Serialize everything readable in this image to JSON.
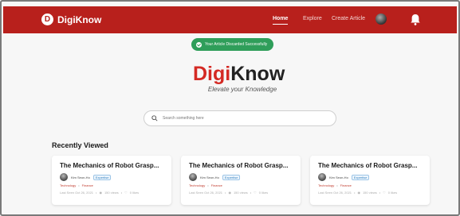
{
  "navbar": {
    "brand": "DigiKnow",
    "brand_logo": "D",
    "links": [
      "Home",
      "Explore",
      "Create Article"
    ],
    "active_link": "Home"
  },
  "toast": {
    "message": "Your Article Discarded Successfully",
    "color": "#2f9e5a"
  },
  "hero": {
    "logo_accent": "Digi",
    "logo_rest": "Know",
    "tagline": "Elevate your Knowledge"
  },
  "search": {
    "placeholder": "Search something here"
  },
  "recent": {
    "title": "Recently Viewed",
    "cards": [
      {
        "title": "The Mechanics of Robot Grasp...",
        "author": "Kim Seon-Ho",
        "badge": "Expertise",
        "tags": [
          "Technology",
          "Finance"
        ],
        "last_seen": "Last Seen Oct 26, 2021",
        "views": "150 views",
        "likes": "0 likes"
      },
      {
        "title": "The Mechanics of Robot Grasp...",
        "author": "Kim Seon-Ho",
        "badge": "Expertise",
        "tags": [
          "Technology",
          "Finance"
        ],
        "last_seen": "Last Seen Oct 26, 2021",
        "views": "150 views",
        "likes": "0 likes"
      },
      {
        "title": "The Mechanics of Robot Grasp...",
        "author": "Kim Seon-Ho",
        "badge": "Expertise",
        "tags": [
          "Technology",
          "Finance"
        ],
        "last_seen": "Last Seen Oct 26, 2021",
        "views": "150 views",
        "likes": "0 likes"
      }
    ]
  },
  "colors": {
    "brand_red": "#b8201c",
    "accent_red": "#d42a24",
    "success_green": "#2f9e5a"
  }
}
